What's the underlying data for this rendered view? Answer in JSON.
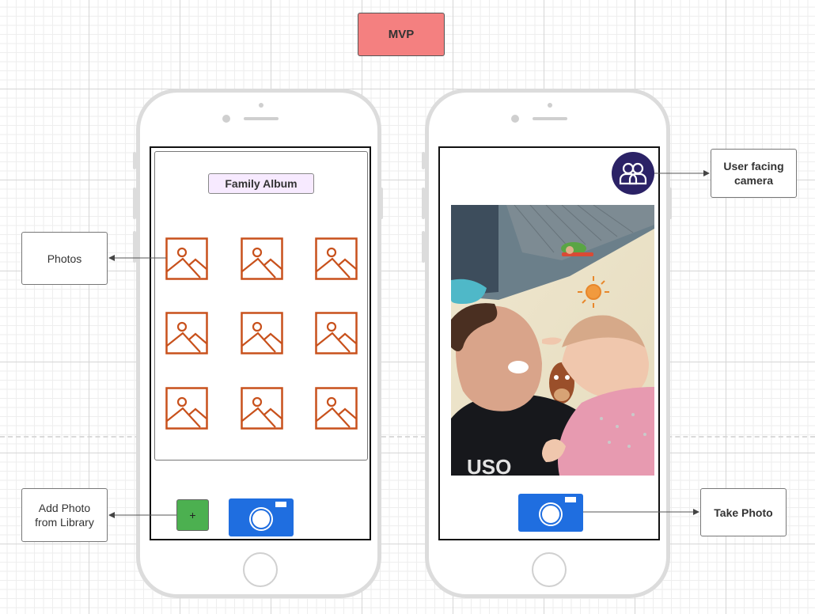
{
  "header": {
    "label": "MVP",
    "color": "#f48080"
  },
  "album_screen": {
    "title": "Family Album",
    "photo_icons": [
      "image-placeholder-icon",
      "image-placeholder-icon",
      "image-placeholder-icon",
      "image-placeholder-icon",
      "image-placeholder-icon",
      "image-placeholder-icon",
      "image-placeholder-icon",
      "image-placeholder-icon",
      "image-placeholder-icon"
    ],
    "photo_icon_color": "#c8511c",
    "add_button_label": "+",
    "add_button_color": "#4cb050",
    "camera_icon": "camera-icon",
    "camera_color": "#1f6ee0"
  },
  "camera_screen": {
    "user_facing_icon": "users-icon",
    "avatar_color": "#2b2266",
    "camera_icon": "camera-icon",
    "camera_color": "#1f6ee0"
  },
  "callouts": {
    "photos": "Photos",
    "add_photo": "Add Photo\nfrom Library",
    "user_facing_camera": "User facing\ncamera",
    "take_photo": "Take Photo"
  }
}
